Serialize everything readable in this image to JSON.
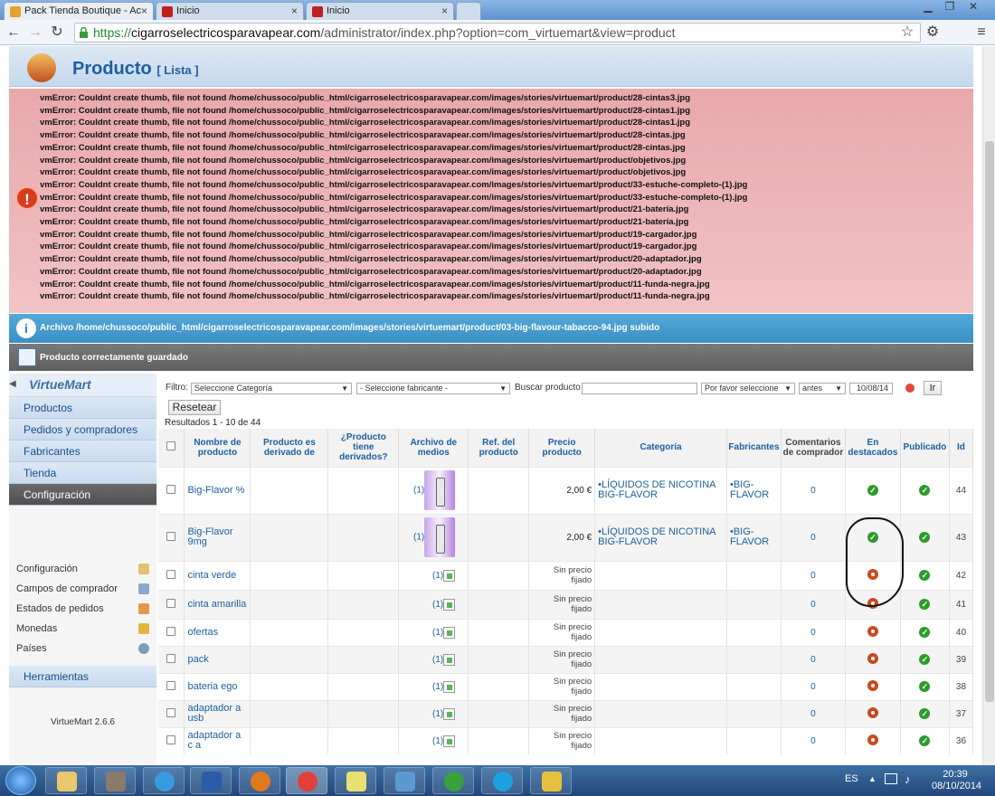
{
  "browser": {
    "tabs": [
      {
        "label": "Pack Tienda Boutique - Ac",
        "close": "×"
      },
      {
        "label": "Inicio",
        "close": "×"
      },
      {
        "label": "Inicio",
        "close": "×"
      }
    ],
    "url_scheme": "https://",
    "url_host": "cigarroselectricosparavapear.com",
    "url_path": "/administrator/index.php?option=com_virtuemart&view=product"
  },
  "header": {
    "title": "Producto",
    "subtitle": "[ Lista ]"
  },
  "errors": [
    "vmError: Couldnt create thumb, file not found /home/chussoco/public_html/cigarroselectricosparavapear.com/images/stories/virtuemart/product/28-cintas3.jpg",
    "vmError: Couldnt create thumb, file not found /home/chussoco/public_html/cigarroselectricosparavapear.com/images/stories/virtuemart/product/28-cintas1.jpg",
    "vmError: Couldnt create thumb, file not found /home/chussoco/public_html/cigarroselectricosparavapear.com/images/stories/virtuemart/product/28-cintas1.jpg",
    "vmError: Couldnt create thumb, file not found /home/chussoco/public_html/cigarroselectricosparavapear.com/images/stories/virtuemart/product/28-cintas.jpg",
    "vmError: Couldnt create thumb, file not found /home/chussoco/public_html/cigarroselectricosparavapear.com/images/stories/virtuemart/product/28-cintas.jpg",
    "vmError: Couldnt create thumb, file not found /home/chussoco/public_html/cigarroselectricosparavapear.com/images/stories/virtuemart/product/objetivos.jpg",
    "vmError: Couldnt create thumb, file not found /home/chussoco/public_html/cigarroselectricosparavapear.com/images/stories/virtuemart/product/objetivos.jpg",
    "vmError: Couldnt create thumb, file not found /home/chussoco/public_html/cigarroselectricosparavapear.com/images/stories/virtuemart/product/33-estuche-completo-(1).jpg",
    "vmError: Couldnt create thumb, file not found /home/chussoco/public_html/cigarroselectricosparavapear.com/images/stories/virtuemart/product/33-estuche-completo-(1).jpg",
    "vmError: Couldnt create thumb, file not found /home/chussoco/public_html/cigarroselectricosparavapear.com/images/stories/virtuemart/product/21-batería.jpg",
    "vmError: Couldnt create thumb, file not found /home/chussoco/public_html/cigarroselectricosparavapear.com/images/stories/virtuemart/product/21-batería.jpg",
    "vmError: Couldnt create thumb, file not found /home/chussoco/public_html/cigarroselectricosparavapear.com/images/stories/virtuemart/product/19-cargador.jpg",
    "vmError: Couldnt create thumb, file not found /home/chussoco/public_html/cigarroselectricosparavapear.com/images/stories/virtuemart/product/19-cargador.jpg",
    "vmError: Couldnt create thumb, file not found /home/chussoco/public_html/cigarroselectricosparavapear.com/images/stories/virtuemart/product/20-adaptador.jpg",
    "vmError: Couldnt create thumb, file not found /home/chussoco/public_html/cigarroselectricosparavapear.com/images/stories/virtuemart/product/20-adaptador.jpg",
    "vmError: Couldnt create thumb, file not found /home/chussoco/public_html/cigarroselectricosparavapear.com/images/stories/virtuemart/product/11-funda-negra.jpg",
    "vmError: Couldnt create thumb, file not found /home/chussoco/public_html/cigarroselectricosparavapear.com/images/stories/virtuemart/product/11-funda-negra.jpg"
  ],
  "info_message": "Archivo /home/chussoco/public_html/cigarroselectricosparavapear.com/images/stories/virtuemart/product/03-big-flavour-tabacco-94.jpg subido",
  "ok_message": "Producto correctamente guardado",
  "sidebar": {
    "logo_text": "VirtueMart",
    "items": [
      "Productos",
      "Pedidos y compradores",
      "Fabricantes",
      "Tienda",
      "Configuración"
    ],
    "sub_items": [
      "Configuración",
      "Campos de comprador",
      "Estados de pedidos",
      "Monedas",
      "Países"
    ],
    "tools": "Herramientas",
    "version": "VirtueMart 2.6.6"
  },
  "filter": {
    "label": "Filtro:",
    "category": "Seleccione Categoría",
    "manufacturer": "- Seleccione fabricante -",
    "search_label": "Buscar producto",
    "search_value": "",
    "select_please": "Por favor seleccione",
    "before": "antes",
    "date": "10/08/14",
    "go": "Ir",
    "reset": "Resetear"
  },
  "results": "Resultados 1 - 10 de 44",
  "table": {
    "headers": [
      "Nombre de producto",
      "Producto es derivado de",
      "¿Producto tiene derivados?",
      "Archivo de medios",
      "Ref. del producto",
      "Precio producto",
      "Categoría",
      "Fabricantes",
      "Comentarios de comprador",
      "En destacados",
      "Publicado",
      "Id"
    ],
    "rows": [
      {
        "name": "Big-Flavor %",
        "media": "(1)",
        "price": "2,00 €",
        "category": "•LÍQUIDOS DE NICOTINA BIG-FLAVOR",
        "manufacturer": "•BIG-FLAVOR",
        "comments": "0",
        "featured": true,
        "published": true,
        "id": "44",
        "thumb": true
      },
      {
        "name": "Big-Flavor 9mg",
        "media": "(1)",
        "price": "2,00 €",
        "category": "•LÍQUIDOS DE NICOTINA BIG-FLAVOR",
        "manufacturer": "•BIG-FLAVOR",
        "comments": "0",
        "featured": true,
        "published": true,
        "id": "43",
        "thumb": true
      },
      {
        "name": "cinta verde",
        "media": "(1)",
        "price": "Sin precio fijado",
        "category": "",
        "manufacturer": "",
        "comments": "0",
        "featured": false,
        "published": true,
        "id": "42",
        "thumb": false
      },
      {
        "name": "cinta amarilla",
        "media": "(1)",
        "price": "Sin precio fijado",
        "category": "",
        "manufacturer": "",
        "comments": "0",
        "featured": false,
        "published": true,
        "id": "41",
        "thumb": false
      },
      {
        "name": "ofertas",
        "media": "(1)",
        "price": "Sin precio fijado",
        "category": "",
        "manufacturer": "",
        "comments": "0",
        "featured": false,
        "published": true,
        "id": "40",
        "thumb": false
      },
      {
        "name": "pack",
        "media": "(1)",
        "price": "Sin precio fijado",
        "category": "",
        "manufacturer": "",
        "comments": "0",
        "featured": false,
        "published": true,
        "id": "39",
        "thumb": false
      },
      {
        "name": "bateria ego",
        "media": "(1)",
        "price": "Sin precio fijado",
        "category": "",
        "manufacturer": "",
        "comments": "0",
        "featured": false,
        "published": true,
        "id": "38",
        "thumb": false
      },
      {
        "name": "adaptador a usb",
        "media": "(1)",
        "price": "Sin precio fijado",
        "category": "",
        "manufacturer": "",
        "comments": "0",
        "featured": false,
        "published": true,
        "id": "37",
        "thumb": false
      },
      {
        "name": "adaptador a c a",
        "media": "(1)",
        "price": "Sin precio fijado",
        "category": "",
        "manufacturer": "",
        "comments": "0",
        "featured": false,
        "published": true,
        "id": "36",
        "thumb": false
      }
    ]
  },
  "taskbar": {
    "lang": "ES",
    "time": "20:39",
    "date": "08/10/2014"
  }
}
